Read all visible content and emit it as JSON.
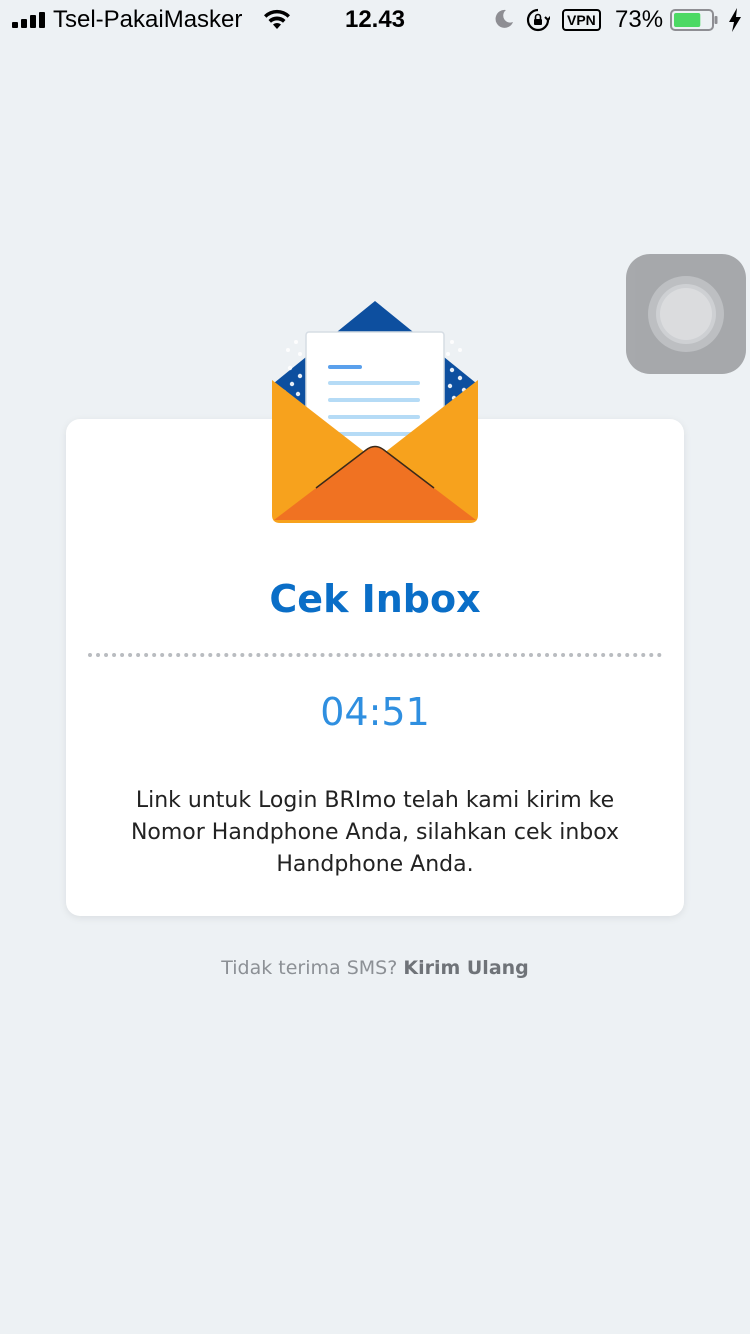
{
  "status_bar": {
    "carrier": "Tsel-PakaiMasker",
    "time": "12.43",
    "vpn_label": "VPN",
    "battery_percent": "73%",
    "battery_level": 0.73,
    "icons": [
      "signal-bars-icon",
      "wifi-icon",
      "moon-icon",
      "rotation-lock-icon",
      "battery-icon",
      "charging-bolt-icon"
    ]
  },
  "assistive_touch": {
    "icon": "assistive-touch-icon"
  },
  "card": {
    "illustration": "open-envelope-icon",
    "title": "Cek Inbox",
    "timer": "04:51",
    "message": "Link untuk Login BRImo telah kami kirim ke Nomor Handphone Anda, silahkan cek inbox Handphone Anda."
  },
  "resend": {
    "prompt": "Tidak terima SMS?",
    "link_label": "Kirim Ulang"
  },
  "colors": {
    "background": "#edf1f4",
    "accent_blue": "#0a6ec7",
    "timer_blue": "#2f8fe0",
    "envelope_orange": "#f7a21d",
    "envelope_dark_orange": "#f07222",
    "envelope_navy": "#0d4f9f"
  }
}
